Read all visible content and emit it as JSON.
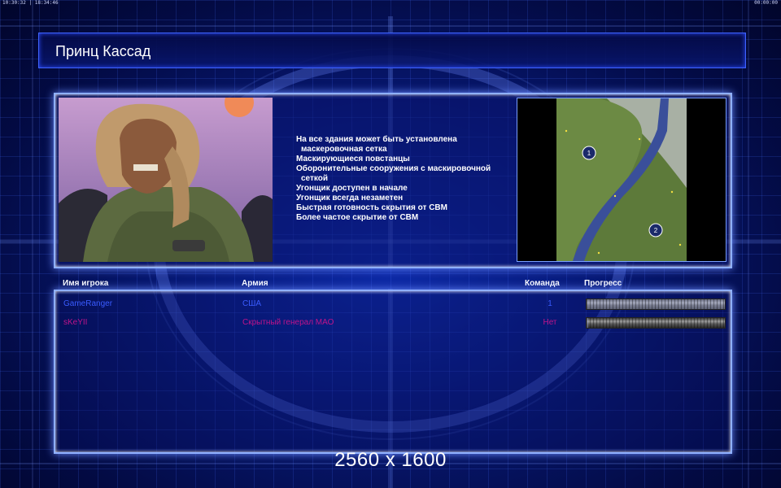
{
  "status_bar": {
    "left": "10:30:32 | 18:34:46",
    "right": "00:00:00"
  },
  "screen": {
    "title": "Принц Кассад"
  },
  "general": {
    "features": [
      "На все здания может быть установлена",
      "маскеровочная сетка",
      "Маскирующиеся повстанцы",
      "Оборонительные сооружения с маскировочной",
      "сеткой",
      "Угонщик доступен в начале",
      "Угонщик всегда незаметен",
      "Быстрая готовность скрытия от СВМ",
      "Более частое скрытие от СВМ"
    ]
  },
  "map": {
    "start_positions": [
      "1",
      "2"
    ]
  },
  "table": {
    "headers": {
      "player": "Имя игрока",
      "army": "Армия",
      "team": "Команда",
      "progress": "Прогресс"
    },
    "rows": [
      {
        "player": "GameRanger",
        "army": "США",
        "team": "1",
        "progress": 1.0,
        "color": "#3a5cff"
      },
      {
        "player": "sKeYII",
        "army": "Скрытный генерал МАО",
        "team": "Нет",
        "progress": 0.01,
        "color": "#c0138a"
      }
    ]
  },
  "watermark": "2560 x 1600",
  "colors": {
    "background": "#061470",
    "panel_border": "#8fb0ff",
    "player1": "#3a5cff",
    "player2": "#c0138a"
  }
}
